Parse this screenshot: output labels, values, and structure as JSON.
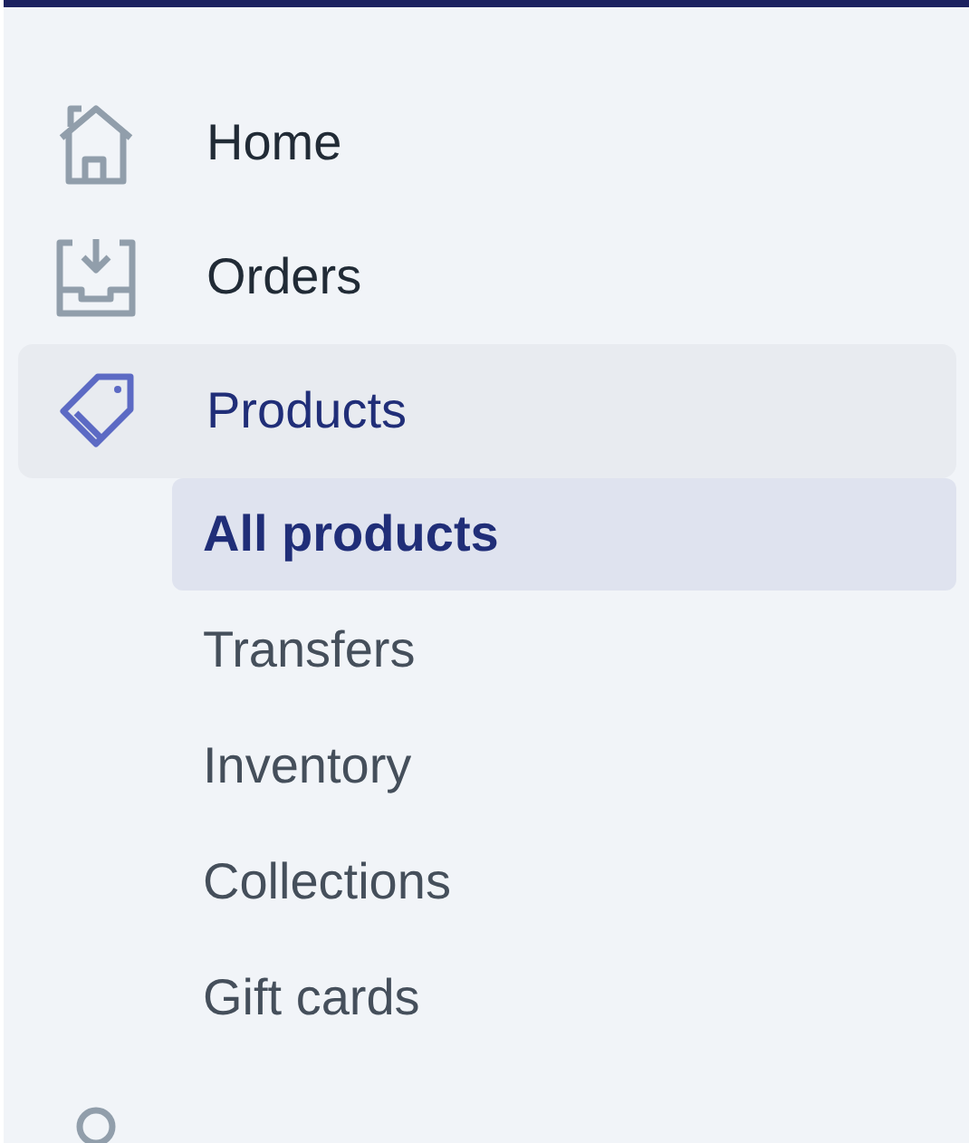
{
  "nav": [
    {
      "kind": "home",
      "label": "Home",
      "selected": false
    },
    {
      "kind": "orders",
      "label": "Orders",
      "selected": false
    },
    {
      "kind": "products",
      "label": "Products",
      "selected": true,
      "children": [
        {
          "label": "All products",
          "selected": true
        },
        {
          "label": "Transfers",
          "selected": false
        },
        {
          "label": "Inventory",
          "selected": false
        },
        {
          "label": "Collections",
          "selected": false
        },
        {
          "label": "Gift cards",
          "selected": false
        }
      ]
    },
    {
      "kind": "customers",
      "selected": false
    }
  ]
}
